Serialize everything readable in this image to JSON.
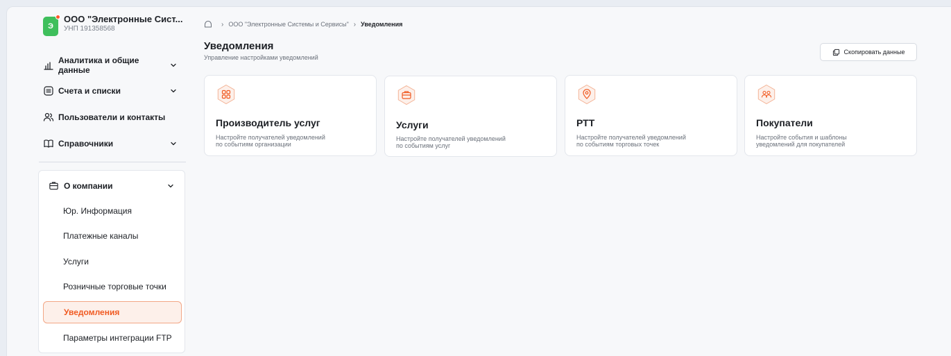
{
  "org": {
    "avatar_letter": "Э",
    "name": "ООО \"Электронные Сист...",
    "unp": "УНП 191358568"
  },
  "sidebar": {
    "items": [
      {
        "label": "Аналитика и общие данные",
        "icon": "chart-bars-icon",
        "has_chevron": true
      },
      {
        "label": "Счета и списки",
        "icon": "list-icon",
        "has_chevron": true
      },
      {
        "label": "Пользователи и контакты",
        "icon": "users-icon",
        "has_chevron": false
      },
      {
        "label": "Справочники",
        "icon": "book-icon",
        "has_chevron": true
      }
    ],
    "company": {
      "label": "О компании",
      "icon": "briefcase-icon",
      "sub_items": [
        {
          "label": "Юр. Информация",
          "active": false
        },
        {
          "label": "Платежные каналы",
          "active": false
        },
        {
          "label": "Услуги",
          "active": false
        },
        {
          "label": "Розничные торговые точки",
          "active": false
        },
        {
          "label": "Уведомления",
          "active": true
        },
        {
          "label": "Параметры интеграции FTP",
          "active": false
        }
      ]
    }
  },
  "breadcrumb": {
    "items": [
      "ООО \"Электронные Системы и Сервисы\"",
      "Уведомления"
    ]
  },
  "page": {
    "title": "Уведомления",
    "subtitle": "Управление настройками уведомлений",
    "copy_button": "Скопировать данные"
  },
  "cards": [
    {
      "title": "Производитель услуг",
      "description": "Настройте получателей уведомлений\nпо событиям организации",
      "icon": "grid-icon"
    },
    {
      "title": "Услуги",
      "description": "Настройте получателей уведомлений\nпо событиям услуг",
      "icon": "briefcase-icon"
    },
    {
      "title": "РТТ",
      "description": "Настройте получателей уведомлений\nпо событиям торговых точек",
      "icon": "location-pin-icon"
    },
    {
      "title": "Покупатели",
      "description": "Настройте события и шаблоны\nуведомлений для покупателей",
      "icon": "users-icon"
    }
  ],
  "colors": {
    "accent": "#f05a22",
    "accent_bg": "#fdf0ea",
    "org_avatar": "#3fbf5c",
    "notification_dot": "#ff5a2a"
  }
}
